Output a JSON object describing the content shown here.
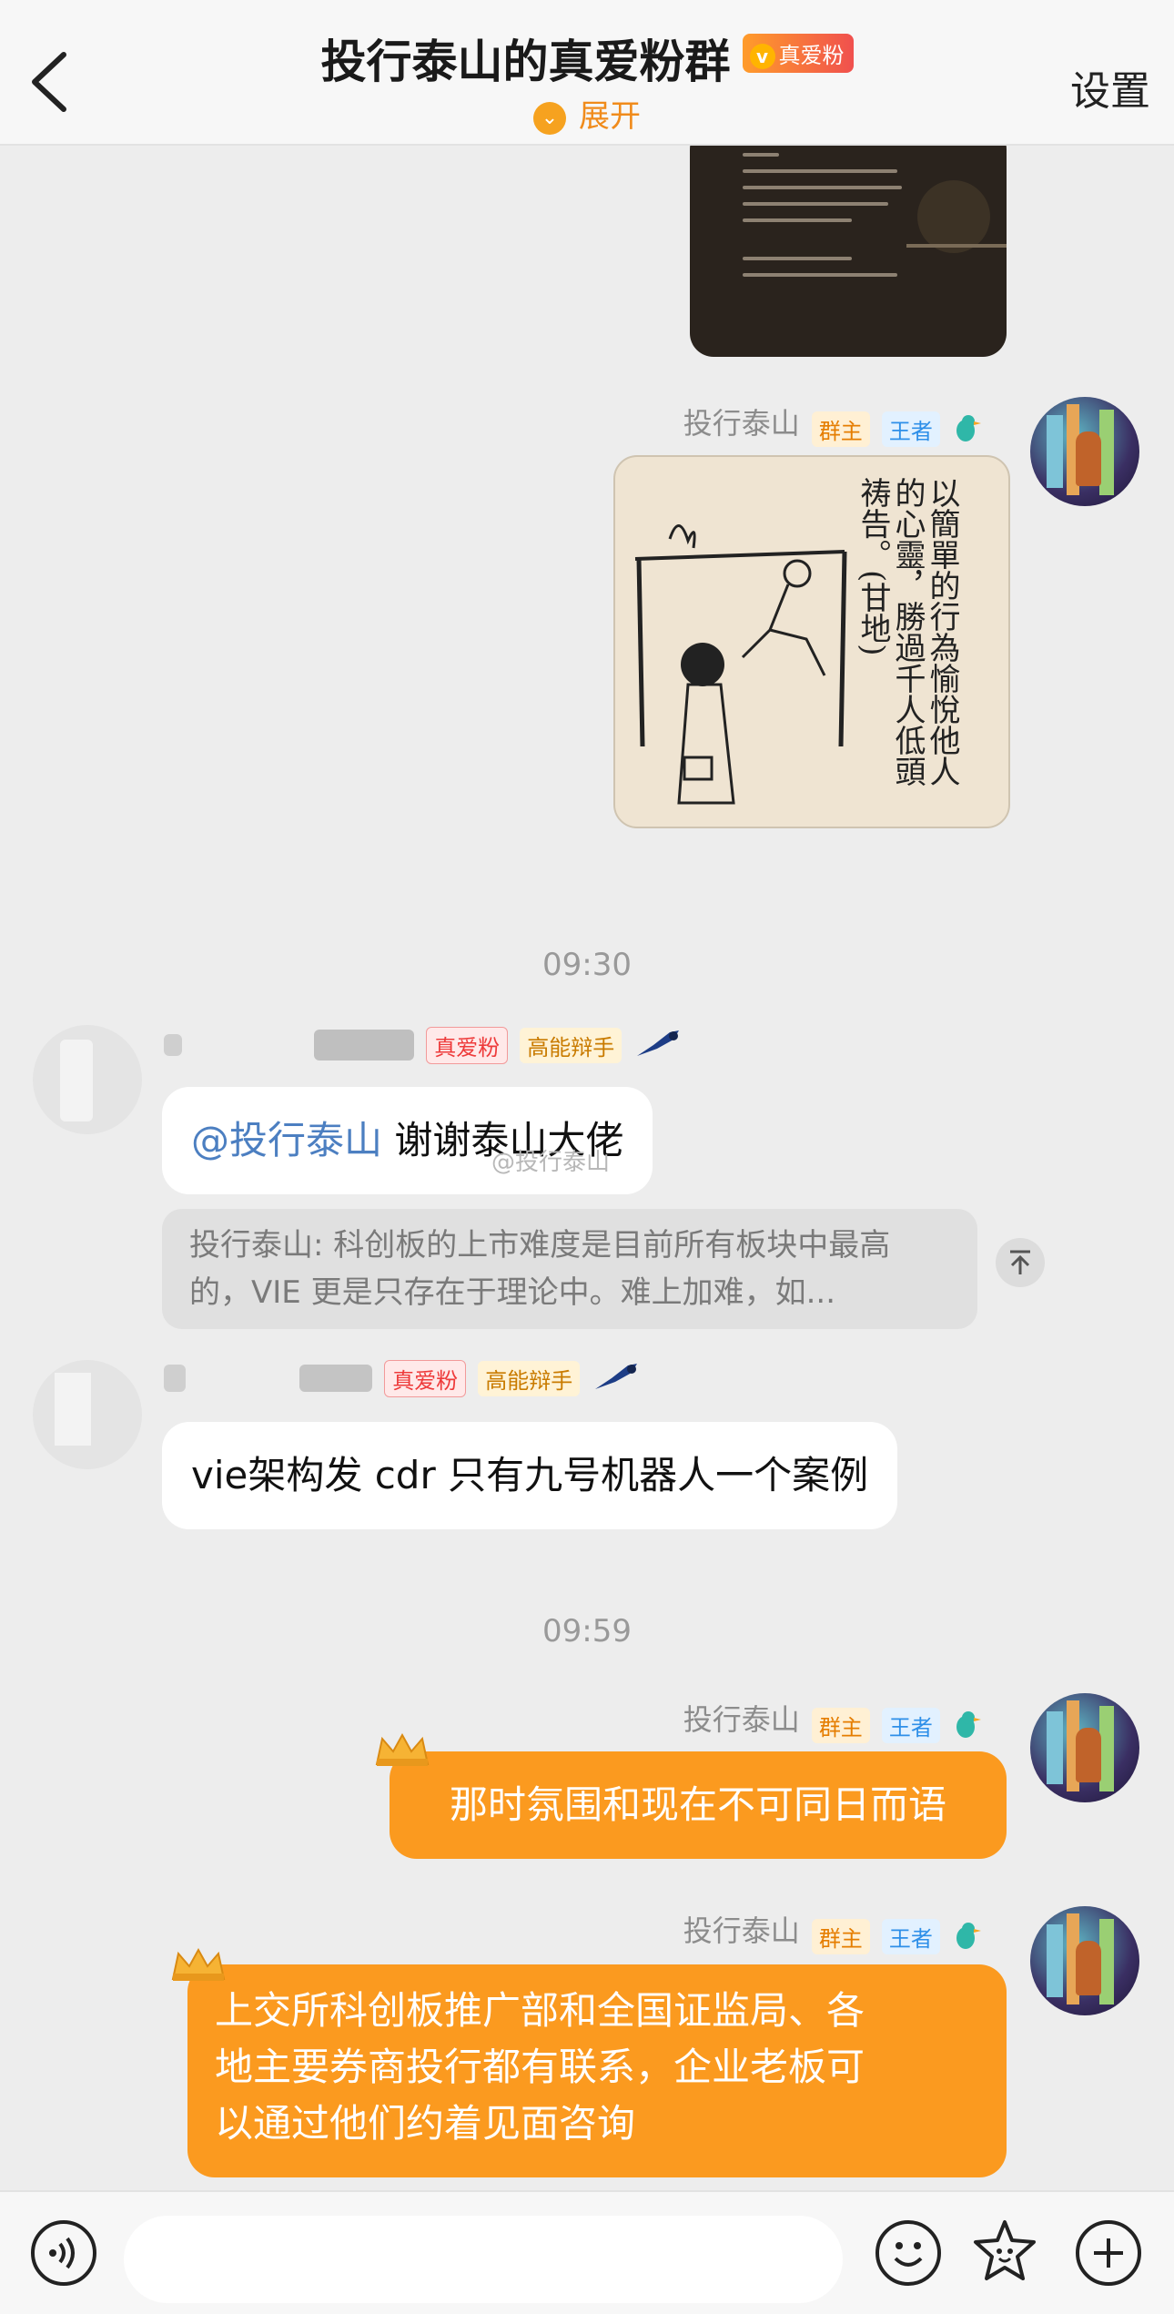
{
  "header": {
    "title": "投行泰山的真爱粉群",
    "title_badge": "真爱粉",
    "expand_label": "展开",
    "settings_label": "设置"
  },
  "messages": {
    "timestamp_1": "09:30",
    "timestamp_2": "09:59",
    "owner": {
      "name": "投行泰山",
      "tag_owner": "群主",
      "tag_level": "王者"
    },
    "fan": {
      "tag_fan": "真爱粉",
      "tag_title": "高能辩手"
    },
    "msg_thanks": {
      "mention": "@投行泰山",
      "text": "谢谢泰山大佬"
    },
    "watermark": "@投行泰山",
    "quote_text": "投行泰山: 科创板的上市难度是目前所有板块中最高的，VIE 更是只存在于理论中。难上加难，如...",
    "msg_vie": "vie架构发 cdr 只有九号机器人一个案例",
    "msg_atmosphere": "那时氛围和现在不可同日而语",
    "msg_sse_lines": [
      "上交所科创板推广部和全国证监局、各",
      "地主要券商投行都有联系，企业老板可",
      "以通过他们约着见面咨询"
    ]
  },
  "images": {
    "comic_caption": "以簡單的行為愉悅他人的心靈，勝過千人低頭祷告。(甘地)"
  },
  "colors": {
    "accent_orange": "#fb9a1f",
    "mention_blue": "#4c7fc1",
    "background": "#ededed"
  }
}
